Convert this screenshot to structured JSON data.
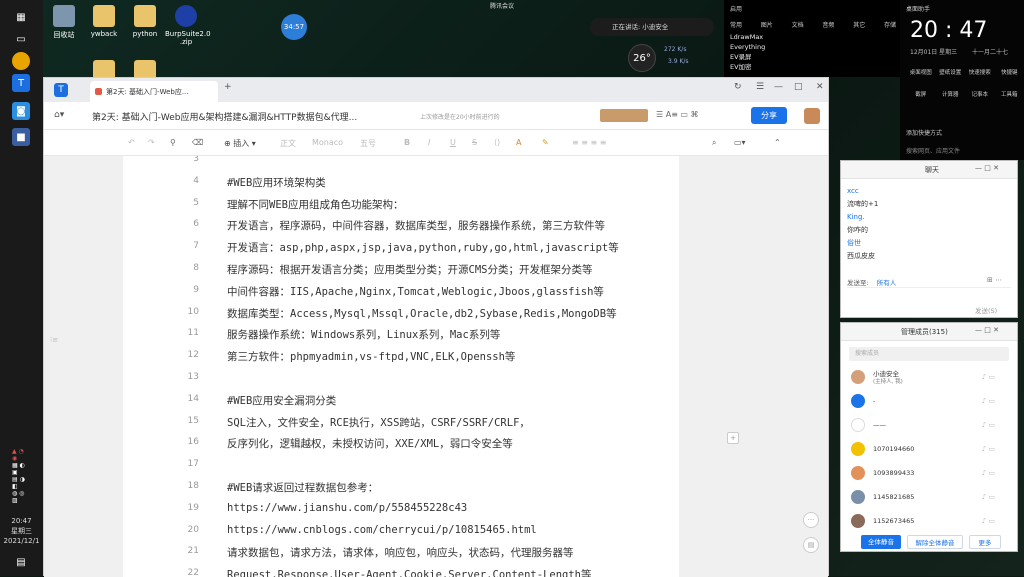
{
  "desktop": {
    "icons": [
      {
        "label": "回收站"
      },
      {
        "label": "ywback"
      },
      {
        "label": "python"
      },
      {
        "label": "BurpSuite2.0\n.zip"
      }
    ],
    "timer_badge": "34:57",
    "top_notice": "腾讯会议",
    "speaking": "正在讲话: 小迪安全",
    "weather_temp": "26°",
    "net_up": "272 K/s",
    "net_down": "3.9 K/s"
  },
  "taskbar": {
    "time": "20:47",
    "weekday": "星期三",
    "date": "2021/12/1"
  },
  "right_top": {
    "tabs": [
      "常用",
      "图片",
      "文档",
      "音频",
      "其它",
      "存储"
    ],
    "apps": [
      "LdrawMax",
      "Everything",
      "EV录屏",
      "EV加密"
    ]
  },
  "clock_widget": {
    "time": "20 : 47",
    "date": "12月01日 星期三",
    "lunar": "十一月二十七",
    "items": [
      "桌面视图",
      "壁纸设置",
      "快速搜索",
      "快捷键",
      "截屏",
      "计算器",
      "记事本",
      "工具箱"
    ],
    "shortcut": "添加快捷方式",
    "search": "搜索网页、应用文件"
  },
  "editor": {
    "tab_title": "第2天: 基础入门-Web应...",
    "doc_title": "第2天: 基础入门-Web应用&架构搭建&漏洞&HTTP数据包&代理...",
    "save_hint": "上次修改是在20小时前进行的",
    "share": "分享",
    "insert": "插入",
    "font_style": "正文",
    "font_name": "Monaco",
    "font_size": "五号",
    "lines": [
      {
        "n": "3",
        "t": ""
      },
      {
        "n": "4",
        "t": "#WEB应用环境架构类"
      },
      {
        "n": "5",
        "t": "理解不同WEB应用组成角色功能架构："
      },
      {
        "n": "6",
        "t": "开发语言，程序源码，中间件容器，数据库类型，服务器操作系统，第三方软件等"
      },
      {
        "n": "7",
        "t": "开发语言：asp,php,aspx,jsp,java,python,ruby,go,html,javascript等"
      },
      {
        "n": "8",
        "t": "程序源码：根据开发语言分类；应用类型分类；开源CMS分类；开发框架分类等"
      },
      {
        "n": "9",
        "t": "中间件容器：IIS,Apache,Nginx,Tomcat,Weblogic,Jboos,glassfish等"
      },
      {
        "n": "10",
        "t": "数据库类型：Access,Mysql,Mssql,Oracle,db2,Sybase,Redis,MongoDB等"
      },
      {
        "n": "11",
        "t": "服务器操作系统：Windows系列，Linux系列，Mac系列等"
      },
      {
        "n": "12",
        "t": "第三方软件：phpmyadmin,vs-ftpd,VNC,ELK,Openssh等"
      },
      {
        "n": "13",
        "t": ""
      },
      {
        "n": "14",
        "t": "#WEB应用安全漏洞分类"
      },
      {
        "n": "15",
        "t": "SQL注入，文件安全，RCE执行，XSS跨站，CSRF/SSRF/CRLF，"
      },
      {
        "n": "16",
        "t": "反序列化，逻辑越权，未授权访问，XXE/XML，弱口令安全等"
      },
      {
        "n": "17",
        "t": ""
      },
      {
        "n": "18",
        "t": "#WEB请求返回过程数据包参考："
      },
      {
        "n": "19",
        "t": "https://www.jianshu.com/p/558455228c43"
      },
      {
        "n": "20",
        "t": "https://www.cnblogs.com/cherrycui/p/10815465.html"
      },
      {
        "n": "21",
        "t": "请求数据包，请求方法，请求体，响应包，响应头，状态码，代理服务器等"
      },
      {
        "n": "22",
        "t": "Request,Response,User-Agent,Cookie,Server,Content-Length等"
      }
    ]
  },
  "chat_panel": {
    "title": "聊天",
    "messages": [
      {
        "who": "xcc",
        "text": "流啤的+1"
      },
      {
        "who": "King.",
        "text": "你咋的"
      },
      {
        "who": "俗世",
        "text": "西瓜皮皮"
      }
    ],
    "send_to_label": "发送至:",
    "send_to_value": "所有人",
    "send_btn": "发送(S)"
  },
  "members_panel": {
    "title": "管理成员(315)",
    "search": "搜索成员",
    "members": [
      {
        "name": "小迪安全",
        "sub": "(主持人, 我)",
        "color": "#d4a07a"
      },
      {
        "name": "-",
        "sub": "",
        "color": "#1a73e8"
      },
      {
        "name": "——",
        "sub": "",
        "color": "#ffffff"
      },
      {
        "name": "1070194660",
        "sub": "",
        "color": "#f2c200"
      },
      {
        "name": "1093899433",
        "sub": "",
        "color": "#e0925a"
      },
      {
        "name": "1145821685",
        "sub": "",
        "color": "#7a8fa8"
      },
      {
        "name": "1152673465",
        "sub": "",
        "color": "#8a6a5a"
      }
    ],
    "btn_mute_all": "全体静音",
    "btn_unmute_all": "解除全体静音",
    "btn_more": "更多"
  }
}
